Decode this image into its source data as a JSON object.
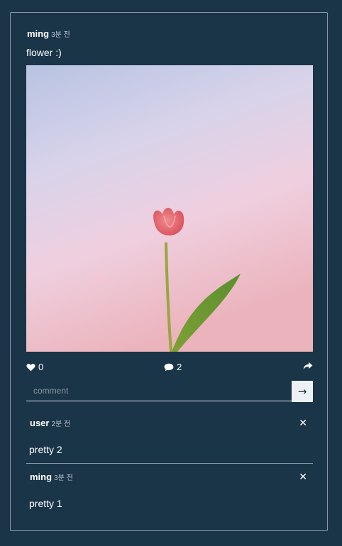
{
  "post": {
    "author": "ming",
    "time": "3분 전",
    "caption": "flower :)",
    "image_icon": "tulip-photo",
    "likes": "0",
    "comment_count": "2"
  },
  "comment_form": {
    "placeholder": "comment",
    "submit_label": "→"
  },
  "comments": [
    {
      "author": "user",
      "time": "2분 전",
      "text": "pretty 2",
      "delete_label": "✕"
    },
    {
      "author": "ming",
      "time": "3분 전",
      "text": "pretty 1",
      "delete_label": "✕"
    }
  ],
  "colors": {
    "background": "#1a3448",
    "text": "#ffffff",
    "muted": "#b9c4cd",
    "border": "#8a9aa8"
  },
  "icons": {
    "like": "heart-icon",
    "comments": "speech-bubble-icon",
    "share": "share-arrow-icon",
    "delete": "close-icon"
  }
}
